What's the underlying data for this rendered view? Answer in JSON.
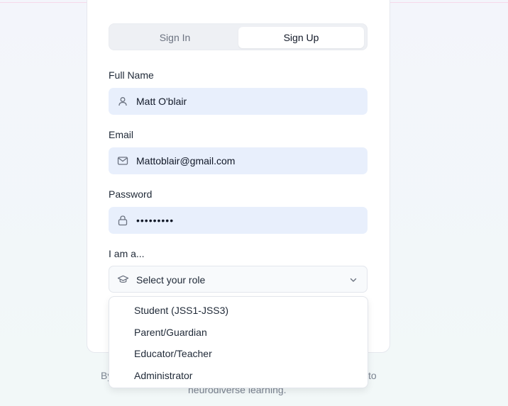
{
  "tabs": {
    "sign_in": "Sign In",
    "sign_up": "Sign Up"
  },
  "form": {
    "full_name_label": "Full Name",
    "full_name_value": "Matt O'blair",
    "email_label": "Email",
    "email_value": "Mattoblair@gmail.com",
    "password_label": "Password",
    "password_value": "•••••••••",
    "role_label": "I am a...",
    "role_placeholder": "Select your role"
  },
  "role_options": [
    "Student (JSS1-JSS3)",
    "Parent/Guardian",
    "Educator/Teacher",
    "Administrator"
  ],
  "footer": {
    "left_fragment": "By",
    "right_fragment": "to",
    "line2": "neurodiverse learning."
  },
  "colors": {
    "accent": "#22c8bc",
    "field_bg": "#e8effc"
  },
  "icons": {
    "full_name": "user-icon",
    "email": "mail-icon",
    "password": "lock-icon",
    "role": "graduation-cap-icon",
    "select": "chevron-down-icon"
  }
}
